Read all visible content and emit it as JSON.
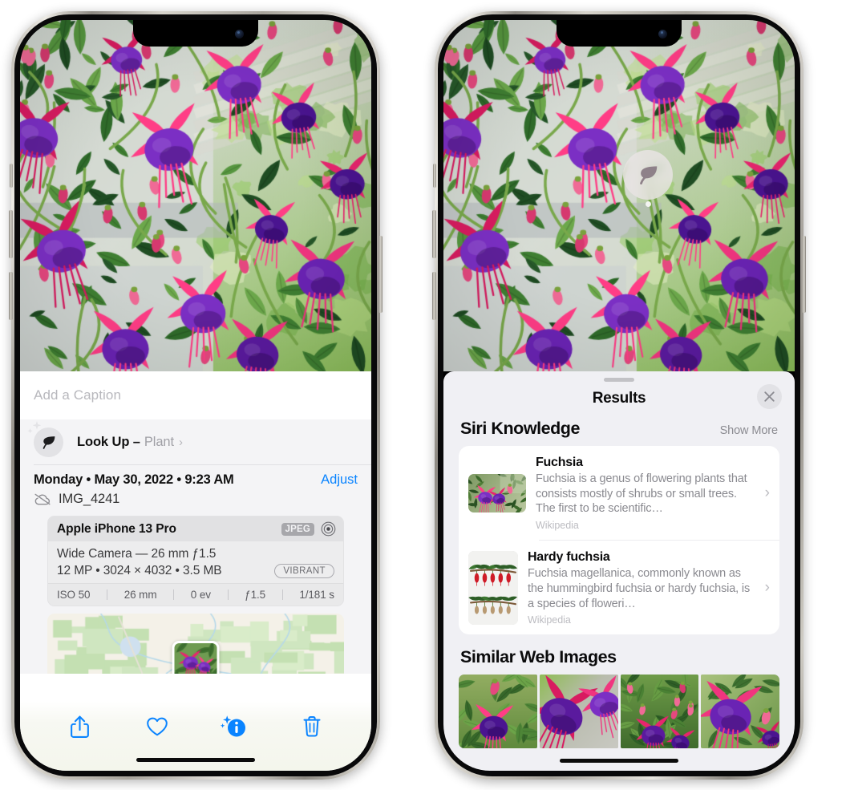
{
  "left_phone": {
    "caption_placeholder": "Add a Caption",
    "lookup": {
      "title": "Look Up –",
      "subject": "Plant",
      "chevron": "›",
      "icon": "leaf-icon"
    },
    "metadata": {
      "datetime": "Monday • May 30, 2022 • 9:23 AM",
      "adjust_label": "Adjust",
      "filename": "IMG_4241",
      "cloud_icon": "cloud-slash-icon"
    },
    "camera": {
      "model": "Apple iPhone 13 Pro",
      "format_tag": "JPEG",
      "aperture_icon": "raw-circle-icon",
      "lens": "Wide Camera — 26 mm ƒ1.5",
      "size_line": "12 MP • 3024 × 4032 • 3.5 MB",
      "style_tag": "VIBRANT",
      "exif": [
        "ISO 50",
        "26 mm",
        "0 ev",
        "ƒ1.5",
        "1/181 s"
      ]
    },
    "toolbar": [
      {
        "name": "share-button",
        "icon": "share-icon"
      },
      {
        "name": "favorite-button",
        "icon": "heart-icon"
      },
      {
        "name": "info-button",
        "icon": "info-sparkle-icon"
      },
      {
        "name": "delete-button",
        "icon": "trash-icon"
      }
    ],
    "accent_color": "#0a84ff"
  },
  "right_phone": {
    "visual_lookup_badge": {
      "icon": "leaf-icon"
    },
    "sheet": {
      "title": "Results",
      "close_icon": "close-icon"
    },
    "siri_knowledge": {
      "heading": "Siri Knowledge",
      "action": "Show More",
      "items": [
        {
          "name": "Fuchsia",
          "description": "Fuchsia is a genus of flowering plants that consists mostly of shrubs or small trees. The first to be scientific…",
          "source": "Wikipedia",
          "chevron": "›"
        },
        {
          "name": "Hardy fuchsia",
          "description": "Fuchsia magellanica, commonly known as the hummingbird fuchsia or hardy fuchsia, is a species of floweri…",
          "source": "Wikipedia",
          "chevron": "›"
        }
      ]
    },
    "similar_web_images": {
      "heading": "Similar Web Images",
      "thumbnails": [
        "fuchsia-web-1",
        "fuchsia-web-2",
        "fuchsia-web-3",
        "fuchsia-web-4"
      ]
    }
  }
}
